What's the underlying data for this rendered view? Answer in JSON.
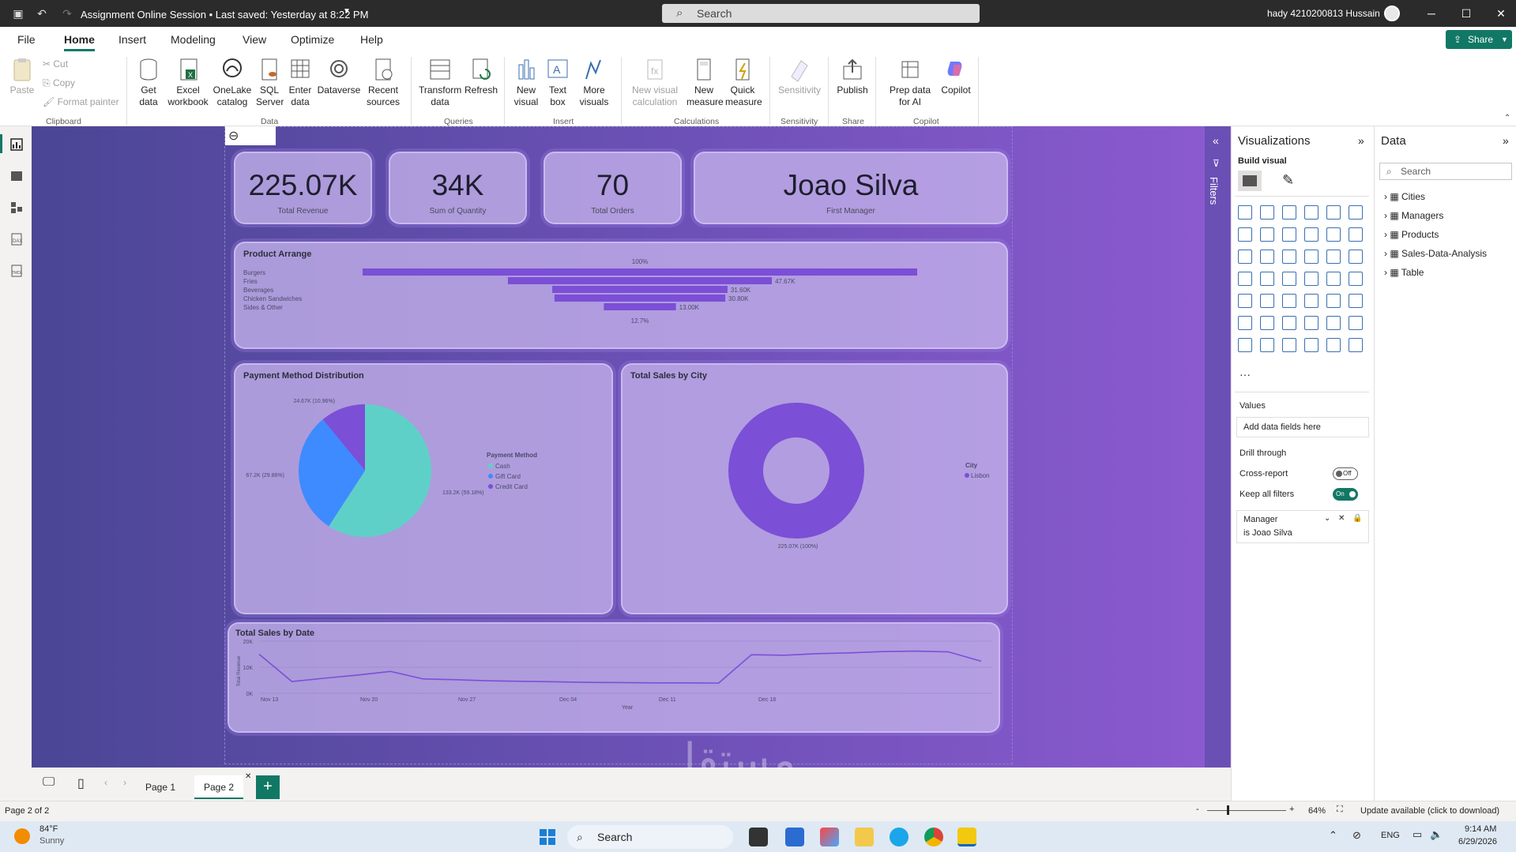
{
  "titlebar": {
    "doc_title": "Assignment Online Session • Last saved: Yesterday at 8:22 PM",
    "search_placeholder": "Search",
    "user": "hady 4210200813 Hussain"
  },
  "menu": {
    "items": [
      "File",
      "Home",
      "Insert",
      "Modeling",
      "View",
      "Optimize",
      "Help"
    ],
    "share": "Share"
  },
  "ribbon": {
    "clipboard": {
      "paste": "Paste",
      "cut": "Cut",
      "copy": "Copy",
      "format_painter": "Format painter",
      "group": "Clipboard"
    },
    "data": {
      "get_data": "Get data",
      "excel": "Excel workbook",
      "onelake": "OneLake catalog",
      "sql": "SQL Server",
      "enter": "Enter data",
      "dataverse": "Dataverse",
      "recent": "Recent sources",
      "group": "Data"
    },
    "queries": {
      "transform": "Transform data",
      "refresh": "Refresh",
      "group": "Queries"
    },
    "insert": {
      "new_visual": "New visual",
      "text_box": "Text box",
      "more": "More visuals",
      "group": "Insert"
    },
    "calc": {
      "new_visual_calc": "New visual calculation",
      "new_measure": "New measure",
      "quick_measure": "Quick measure",
      "group": "Calculations"
    },
    "sensitivity": {
      "label": "Sensitivity",
      "group": "Sensitivity"
    },
    "share": {
      "publish": "Publish",
      "group": "Share"
    },
    "copilot": {
      "prep": "Prep data for AI",
      "copilot": "Copilot",
      "group": "Copilot"
    }
  },
  "kpis": [
    {
      "value": "225.07K",
      "label": "Total Revenue"
    },
    {
      "value": "34K",
      "label": "Sum of Quantity"
    },
    {
      "value": "70",
      "label": "Total Orders"
    },
    {
      "value": "Joao Silva",
      "label": "First Manager"
    }
  ],
  "funnel": {
    "title": "Product Arrange",
    "top_pct": "100%",
    "bottom_pct": "12.7%",
    "items": [
      {
        "name": "Burgers",
        "value": 100,
        "label": ""
      },
      {
        "name": "Fries",
        "value": 47.6,
        "label": "47.67K"
      },
      {
        "name": "Beverages",
        "value": 31.6,
        "label": "31.60K"
      },
      {
        "name": "Chicken Sandwiches",
        "value": 30.8,
        "label": "30.80K"
      },
      {
        "name": "Sides & Other",
        "value": 13.0,
        "label": "13.00K"
      }
    ]
  },
  "pie": {
    "title": "Payment Method Distribution",
    "legend_title": "Payment Method",
    "slices": [
      {
        "name": "Cash",
        "value": 59.18,
        "color": "#5fd0c8",
        "label": "133.2K (59.18%)"
      },
      {
        "name": "Gift Card",
        "value": 29.86,
        "color": "#3d8bff",
        "label": "67.2K (29.86%)"
      },
      {
        "name": "Credit Card",
        "value": 10.96,
        "color": "#7b4fd6",
        "label": "24.67K (10.96%)"
      }
    ]
  },
  "donut": {
    "title": "Total Sales by City",
    "legend_title": "City",
    "legend_item": "Lisbon",
    "label": "225.07K (100%)",
    "color": "#7b4fd6"
  },
  "chart_data": {
    "type": "line",
    "title": "Total Sales by Date",
    "xlabel": "Year",
    "ylabel": "Total Revenue",
    "yticks": [
      "20K",
      "10K",
      "0K"
    ],
    "ylim": [
      0,
      20000
    ],
    "xticks": [
      "Nov 13",
      "Nov 20",
      "Nov 27",
      "Dec 04",
      "Dec 11",
      "Dec 18"
    ],
    "series": [
      {
        "values": [
          15000,
          4500,
          5800,
          7000,
          8400,
          5500,
          5200,
          4800,
          4600,
          4400,
          4200,
          4100,
          4000,
          4000,
          3900,
          14800,
          14600,
          15200,
          15500,
          16000,
          16200,
          15900,
          12300
        ]
      }
    ]
  },
  "viz_pane": {
    "title": "Visualizations",
    "build": "Build visual",
    "values": "Values",
    "add_fields": "Add data fields here",
    "drill": "Drill through",
    "cross": "Cross-report",
    "cross_state": "Off",
    "keep": "Keep all filters",
    "keep_state": "On",
    "filter_field": "Manager",
    "filter_value": "is Joao Silva"
  },
  "data_pane": {
    "title": "Data",
    "search": "Search",
    "tables": [
      "Cities",
      "Managers",
      "Products",
      "Sales-Data-Analysis",
      "Table"
    ]
  },
  "filters_label": "Filters",
  "pages": [
    "Page 1",
    "Page 2"
  ],
  "status": {
    "page": "Page 2 of 2",
    "zoom": "64%",
    "update": "Update available (click to download)"
  },
  "taskbar": {
    "temp": "84°F",
    "weather": "Sunny",
    "search": "Search",
    "lang": "ENG",
    "time": "9:14 AM",
    "date": "6/29/2026"
  },
  "watermark": "مستقل"
}
